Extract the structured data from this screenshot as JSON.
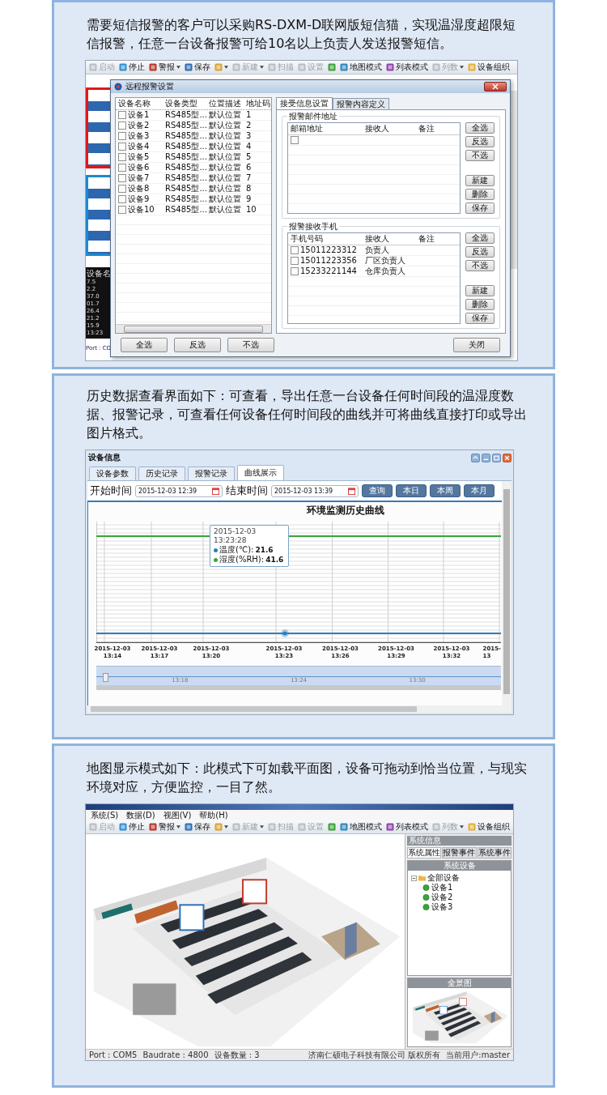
{
  "sms_section": {
    "description": "需要短信报警的客户可以采购RS-DXM-D联网版短信猫，实现温湿度超限短信报警，任意一台设备报警可给10名以上负责人发送报警短信。",
    "toolbar": [
      {
        "label": "启动",
        "disabled": true,
        "dropdown": false
      },
      {
        "label": "停止",
        "disabled": false,
        "dropdown": false
      },
      {
        "label": "警报",
        "disabled": false,
        "dropdown": true
      },
      {
        "label": "保存",
        "disabled": false,
        "dropdown": false
      },
      {
        "disabled": false,
        "dropdown": true
      },
      {
        "label": "新建",
        "disabled": true,
        "dropdown": true
      },
      {
        "label": "扫描",
        "disabled": true,
        "dropdown": false
      },
      {
        "label": "设置",
        "disabled": true,
        "dropdown": false
      },
      {
        "disabled": false,
        "dropdown": false
      },
      {
        "label": "地图模式",
        "disabled": false,
        "dropdown": false
      },
      {
        "label": "列表模式",
        "disabled": false,
        "dropdown": false
      },
      {
        "label": "列数",
        "disabled": true,
        "dropdown": true
      },
      {
        "label": "设备组织",
        "disabled": false,
        "dropdown": false
      }
    ],
    "monitor": {
      "header": "设备名",
      "readings": [
        "7.5",
        "2.2",
        "37.0",
        "01.7",
        "26.4",
        "21.2",
        "15.9"
      ],
      "time": "13:23",
      "status": "Port : CO"
    },
    "dialog": {
      "title": "远程报警设置",
      "device_list": {
        "columns": [
          "设备名称",
          "设备类型",
          "位置描述",
          "地址码"
        ],
        "rows": [
          {
            "checked": false,
            "cells": [
              "设备1",
              "RS485型...",
              "默认位置",
              "1"
            ]
          },
          {
            "checked": false,
            "cells": [
              "设备2",
              "RS485型...",
              "默认位置",
              "2"
            ]
          },
          {
            "checked": false,
            "cells": [
              "设备3",
              "RS485型...",
              "默认位置",
              "3"
            ]
          },
          {
            "checked": false,
            "cells": [
              "设备4",
              "RS485型...",
              "默认位置",
              "4"
            ]
          },
          {
            "checked": false,
            "cells": [
              "设备5",
              "RS485型...",
              "默认位置",
              "5"
            ]
          },
          {
            "checked": false,
            "cells": [
              "设备6",
              "RS485型...",
              "默认位置",
              "6"
            ]
          },
          {
            "checked": false,
            "cells": [
              "设备7",
              "RS485型...",
              "默认位置",
              "7"
            ]
          },
          {
            "checked": false,
            "cells": [
              "设备8",
              "RS485型...",
              "默认位置",
              "8"
            ]
          },
          {
            "checked": false,
            "cells": [
              "设备9",
              "RS485型...",
              "默认位置",
              "9"
            ]
          },
          {
            "checked": false,
            "cells": [
              "设备10",
              "RS485型...",
              "默认位置",
              "10"
            ]
          }
        ]
      },
      "tabs": [
        {
          "label": "接受信息设置",
          "selected": true
        },
        {
          "label": "报警内容定义",
          "selected": false
        }
      ],
      "email_group": {
        "title": "报警邮件地址",
        "columns": [
          "邮箱地址",
          "接收人",
          "备注"
        ],
        "rows": [
          {
            "checked": false
          }
        ],
        "buttons": [
          "全选",
          "反选",
          "不选",
          "新建",
          "删除",
          "保存"
        ]
      },
      "phone_group": {
        "title": "报警接收手机",
        "columns": [
          "手机号码",
          "接收人",
          "备注"
        ],
        "rows": [
          {
            "checked": false,
            "cells": [
              "15011223312",
              "负责人"
            ]
          },
          {
            "checked": false,
            "cells": [
              "15011223356",
              "厂区负责人"
            ]
          },
          {
            "checked": false,
            "cells": [
              "15233221144",
              "仓库负责人"
            ]
          }
        ],
        "buttons": [
          "全选",
          "反选",
          "不选",
          "新建",
          "删除",
          "保存"
        ]
      },
      "footer_buttons": [
        "全选",
        "反选",
        "不选"
      ],
      "close_button": "关闭"
    }
  },
  "history_section": {
    "description": "历史数据查看界面如下：可查看，导出任意一台设备任何时间段的温湿度数据、报警记录，可查看任何设备任何时间段的曲线并可将曲线直接打印或导出图片格式。",
    "window_title": "设备信息",
    "tabs": [
      {
        "label": "设备参数",
        "selected": false
      },
      {
        "label": "历史记录",
        "selected": false
      },
      {
        "label": "报警记录",
        "selected": false
      },
      {
        "label": "曲线展示",
        "selected": true
      }
    ],
    "start_label": "开始时间",
    "start_value": "2015-12-03 12:39",
    "end_label": "结束时间",
    "end_value": "2015-12-03 13:39",
    "buttons": [
      "查询",
      "本日",
      "本周",
      "本月"
    ],
    "chart": {
      "title": "环境监测历史曲线",
      "x_labels": [
        {
          "date": "2015-12-03",
          "time": "13:14"
        },
        {
          "date": "2015-12-03",
          "time": "13:17"
        },
        {
          "date": "2015-12-03",
          "time": "13:20"
        },
        {
          "date": "2015-12-03",
          "time": "13:23"
        },
        {
          "date": "2015-12-03",
          "time": "13:26"
        },
        {
          "date": "2015-12-03",
          "time": "13:29"
        },
        {
          "date": "2015-12-03",
          "time": "13:32"
        },
        {
          "date": "2015-",
          "time": "13"
        }
      ],
      "tooltip": {
        "date": "2015-12-03",
        "clock": "13:23:28",
        "items": [
          {
            "label": "温度(℃):",
            "value": "21.6",
            "color": "#2a7fc1"
          },
          {
            "label": "湿度(%RH):",
            "value": "41.6",
            "color": "#3aa53a"
          }
        ]
      },
      "navigator_labels": [
        "13:18",
        "13:24",
        "13:30"
      ]
    }
  },
  "map_section": {
    "description": "地图显示模式如下：此模式下可如载平面图，设备可拖动到恰当位置，与现实环境对应，方便监控，一目了然。",
    "menu": [
      "系统(S)",
      "数据(D)",
      "视图(V)",
      "帮助(H)"
    ],
    "toolbar": [
      {
        "label": "启动",
        "disabled": true,
        "dropdown": false
      },
      {
        "label": "停止",
        "disabled": false,
        "dropdown": false
      },
      {
        "label": "警报",
        "disabled": false,
        "dropdown": true
      },
      {
        "label": "保存",
        "disabled": false,
        "dropdown": false
      },
      {
        "disabled": false,
        "dropdown": true
      },
      {
        "label": "新建",
        "disabled": true,
        "dropdown": true
      },
      {
        "label": "扫描",
        "disabled": true,
        "dropdown": false
      },
      {
        "label": "设置",
        "disabled": true,
        "dropdown": false
      },
      {
        "disabled": false,
        "dropdown": false
      },
      {
        "label": "地图模式",
        "disabled": false,
        "dropdown": false
      },
      {
        "label": "列表模式",
        "disabled": false,
        "dropdown": false
      },
      {
        "label": "列数",
        "disabled": true,
        "dropdown": true
      },
      {
        "label": "设备组织",
        "disabled": false,
        "dropdown": false
      }
    ],
    "side_panel": {
      "title": "系统信息",
      "tabs": [
        {
          "label": "系统属性",
          "selected": true
        },
        {
          "label": "报警事件",
          "selected": false
        },
        {
          "label": "系统事件",
          "selected": false
        }
      ],
      "tree_title": "系统设备",
      "tree": [
        {
          "label": "全部设备",
          "expanded": true,
          "children": [
            {
              "label": "设备1"
            },
            {
              "label": "设备2"
            },
            {
              "label": "设备3"
            }
          ]
        }
      ],
      "overview_title": "全景图"
    },
    "status_bar": [
      "Port : COM5",
      "Baudrate : 4800",
      "设备数量 : 3"
    ],
    "copyright": "济南仁硕电子科技有限公司 版权所有",
    "user": "当前用户:master"
  }
}
